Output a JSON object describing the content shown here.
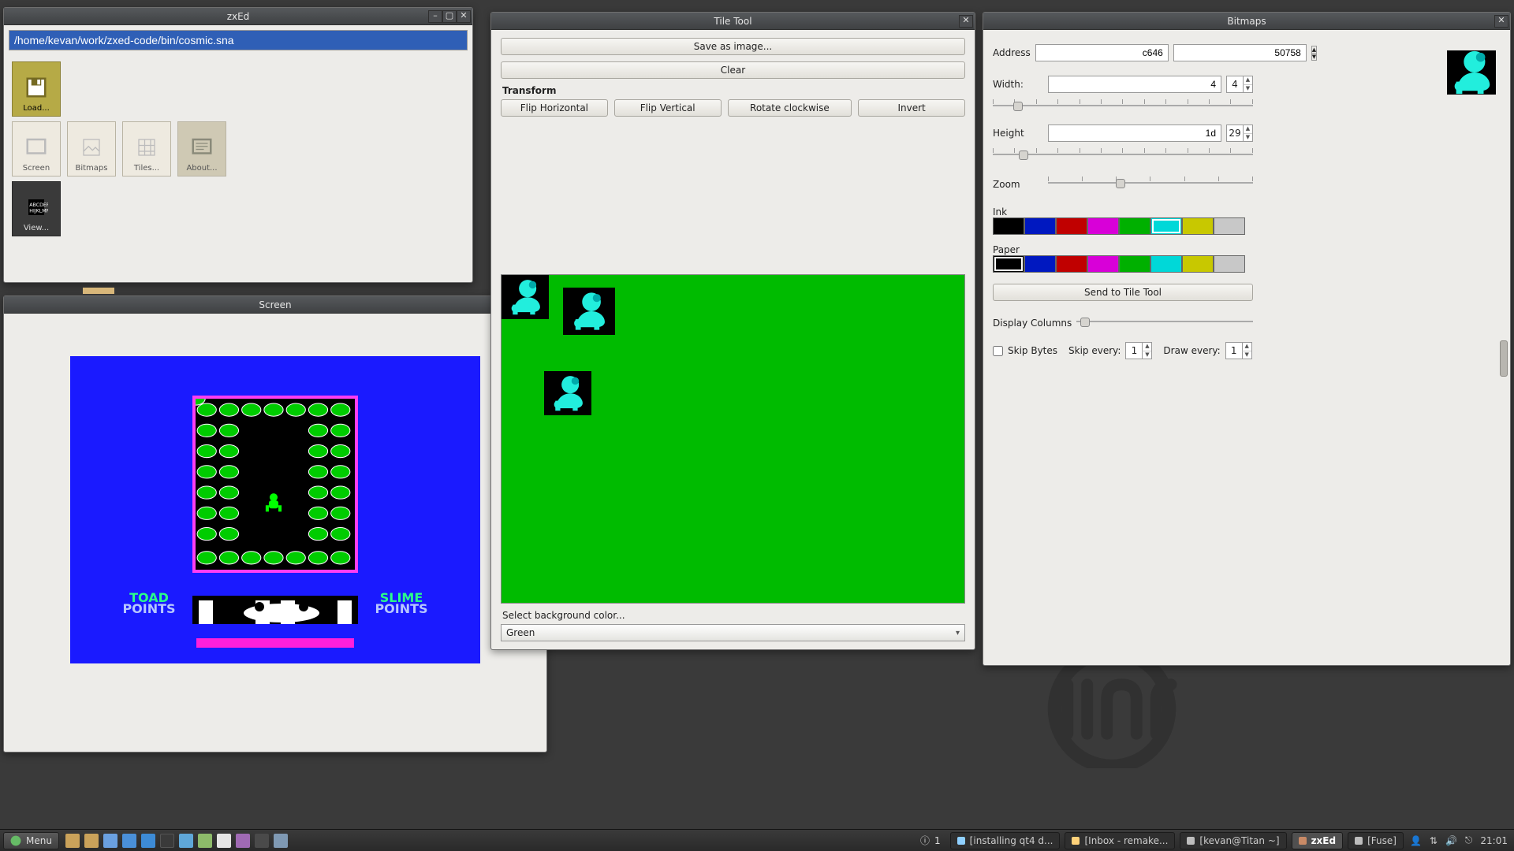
{
  "zxed": {
    "title": "zxEd",
    "path": "/home/kevan/work/zxed-code/bin/cosmic.sna",
    "icons": {
      "load": "Load...",
      "screen": "Screen",
      "bitmaps": "Bitmaps",
      "tiles": "Tiles...",
      "about": "About...",
      "view": "View..."
    }
  },
  "screen_window": {
    "title": "Screen",
    "hud": {
      "left1": "TOAD",
      "left2": "POINTS",
      "right1": "SLIME",
      "right2": "POINTS"
    }
  },
  "tiletool": {
    "title": "Tile Tool",
    "save": "Save as image...",
    "clear": "Clear",
    "transform_label": "Transform",
    "fliph": "Flip Horizontal",
    "flipv": "Flip Vertical",
    "rotate": "Rotate clockwise",
    "invert": "Invert",
    "bg_label": "Select background color...",
    "bg_value": "Green"
  },
  "bitmaps": {
    "title": "Bitmaps",
    "address_label": "Address",
    "address_hex": "c646",
    "address_dec": "50758",
    "width_label": "Width:",
    "width_hex": "4",
    "width_dec": "4",
    "height_label": "Height",
    "height_hex": "1d",
    "height_dec": "29",
    "zoom_label": "Zoom",
    "ink_label": "Ink",
    "paper_label": "Paper",
    "send": "Send to Tile Tool",
    "dispcols": "Display Columns",
    "skipbytes": "Skip Bytes",
    "skipevery": "Skip every:",
    "skipevery_v": "1",
    "drawevery": "Draw every:",
    "drawevery_v": "1"
  },
  "palette": [
    "#000000",
    "#0018c0",
    "#c00000",
    "#d800d8",
    "#00b000",
    "#00d8d8",
    "#c8c800",
    "#c8c8c8"
  ],
  "ink_selected": 5,
  "paper_selected": 0,
  "taskbar": {
    "menu": "Menu",
    "ws_badge": "1",
    "tasks": [
      {
        "label": "[installing qt4 d...",
        "active": false,
        "color": "#8fd0ff"
      },
      {
        "label": "[Inbox - remake...",
        "active": false,
        "color": "#ffd27a"
      },
      {
        "label": "[kevan@Titan ~]",
        "active": false,
        "color": "#bdbdbd"
      },
      {
        "label": "zxEd",
        "active": true,
        "color": "#c98a66"
      },
      {
        "label": "[Fuse]",
        "active": false,
        "color": "#bdbdbd"
      }
    ],
    "clock": "21:01"
  }
}
